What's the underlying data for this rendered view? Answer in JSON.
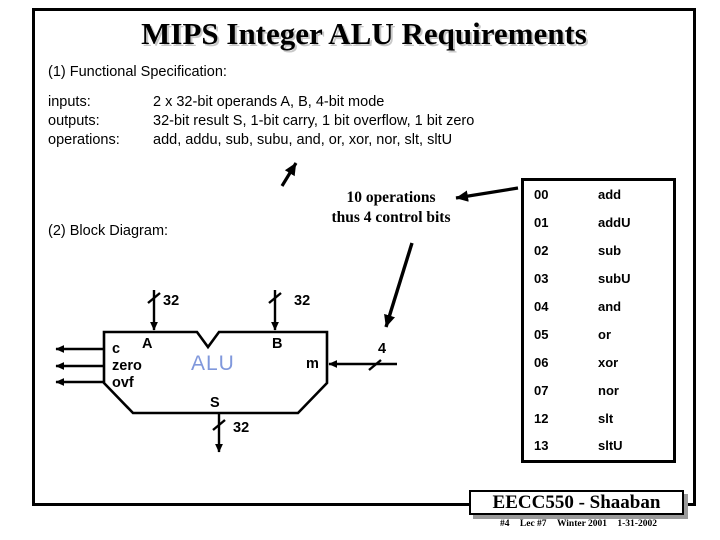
{
  "slide": {
    "title": "MIPS Integer ALU Requirements",
    "section1": "(1) Functional Specification:",
    "section2": "(2) Block Diagram:",
    "spec": [
      {
        "key": "inputs:",
        "value": "2 x 32-bit operands A, B, 4-bit mode"
      },
      {
        "key": "outputs:",
        "value": "32-bit result S, 1-bit carry, 1 bit overflow, 1 bit zero"
      },
      {
        "key": "operations:",
        "value": "add, addu, sub, subu, and, or, xor, nor, slt, sltU"
      }
    ],
    "annotation": {
      "line1": "10 operations",
      "line2": "thus 4 control bits"
    },
    "opcodes": [
      {
        "code": "00",
        "mnemonic": "add"
      },
      {
        "code": "01",
        "mnemonic": "addU"
      },
      {
        "code": "02",
        "mnemonic": "sub"
      },
      {
        "code": "03",
        "mnemonic": "subU"
      },
      {
        "code": "04",
        "mnemonic": "and"
      },
      {
        "code": "05",
        "mnemonic": "or"
      },
      {
        "code": "06",
        "mnemonic": "xor"
      },
      {
        "code": "07",
        "mnemonic": "nor"
      },
      {
        "code": "12",
        "mnemonic": "slt"
      },
      {
        "code": "13",
        "mnemonic": "sltU"
      }
    ],
    "diagram": {
      "block_label": "ALU",
      "input_a": "A",
      "input_b": "B",
      "input_m": "m",
      "output_s": "S",
      "flag_c": "c",
      "flag_zero": "zero",
      "flag_ovf": "ovf",
      "width_a": "32",
      "width_b": "32",
      "width_s": "32",
      "width_m": "4"
    },
    "footer": {
      "course": "EECC550 - Shaaban",
      "slide_no": "#4",
      "lecture": "Lec #7",
      "term": "Winter 2001",
      "date": "1-31-2002"
    },
    "colors": {
      "alu_label": "#8098dc",
      "ink": "#000000",
      "shadow": "#9a9a9a"
    }
  }
}
